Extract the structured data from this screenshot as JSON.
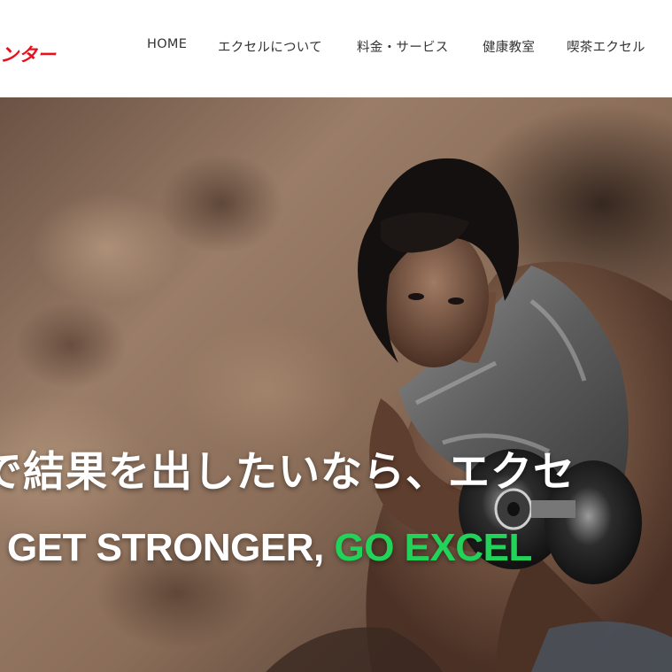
{
  "header": {
    "logo_text": "ンター"
  },
  "nav": {
    "items": [
      {
        "label": "HOME"
      },
      {
        "label": "エクセルについて"
      },
      {
        "label": "料金・サービス"
      },
      {
        "label": "健康教室"
      },
      {
        "label": "喫茶エクセル"
      }
    ]
  },
  "hero": {
    "headline": "で結果を出したいなら、エクセ",
    "tagline_part1": "GET STRONGER, ",
    "tagline_part2": "GO EXCEL"
  },
  "colors": {
    "logo": "#e8101c",
    "tagline_accent": "#22d35a",
    "nav_text": "#333333"
  }
}
